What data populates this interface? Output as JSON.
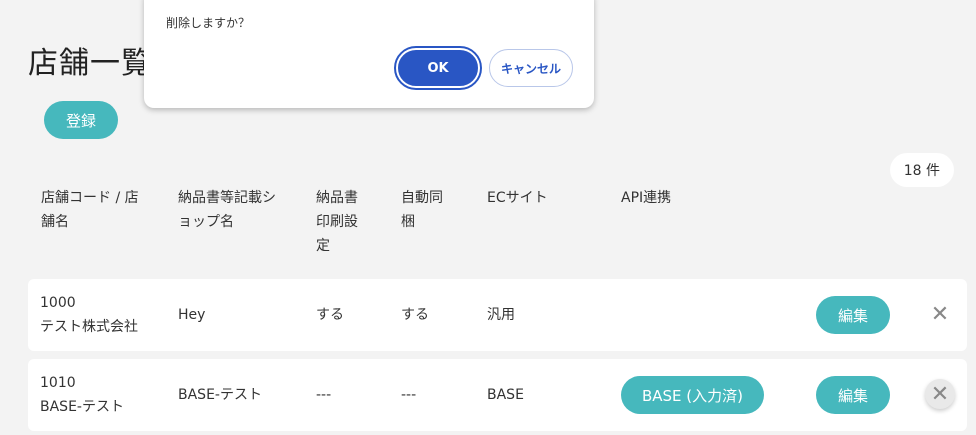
{
  "page": {
    "title": "店舗一覧"
  },
  "actions": {
    "register_label": "登録"
  },
  "count": {
    "label": "18 件"
  },
  "table": {
    "headers": [
      [
        "店舗コード / 店",
        "舗名"
      ],
      [
        "納品書等記載シ",
        "ョップ名"
      ],
      [
        "納品書",
        "印刷設",
        "定"
      ],
      [
        "自動同",
        "梱"
      ],
      [
        "ECサイト"
      ],
      [
        "API連携"
      ]
    ],
    "rows": [
      {
        "code": "1000",
        "name": "テスト株式会社",
        "shop_name": "Hey",
        "print_setting": "する",
        "auto_bundle": "する",
        "ec_site": "汎用",
        "api": "",
        "edit_label": "編集"
      },
      {
        "code": "1010",
        "name": "BASE-テスト",
        "shop_name": "BASE-テスト",
        "print_setting": "---",
        "auto_bundle": "---",
        "ec_site": "BASE",
        "api": "BASE (入力済)",
        "edit_label": "編集"
      }
    ]
  },
  "dialog": {
    "message": "削除しますか？",
    "ok_label": "OK",
    "cancel_label": "キャンセル"
  },
  "icons": {
    "close": "close-icon"
  },
  "colors": {
    "accent": "#46b8bd",
    "primary": "#2956c4",
    "background": "#f3f3f3"
  }
}
